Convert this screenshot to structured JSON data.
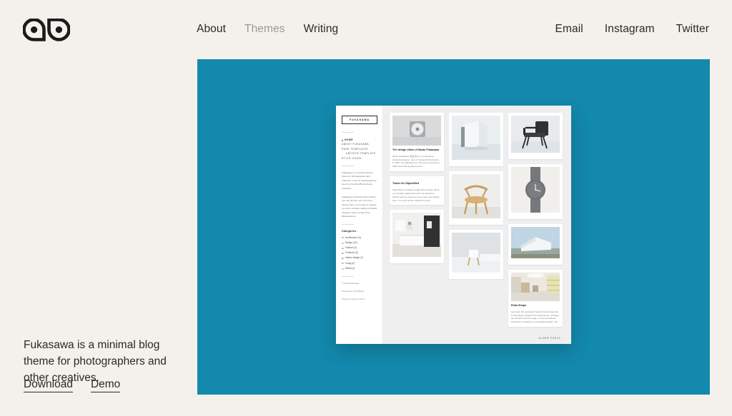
{
  "site": {
    "logo_alt": "fukasawa-double-a-logo",
    "background_color": "#f4f1ec",
    "accent_color": "#1389ad",
    "text_color": "#2b2926"
  },
  "nav_main": [
    {
      "label": "About",
      "state": "default"
    },
    {
      "label": "Themes",
      "state": "muted"
    },
    {
      "label": "Writing",
      "state": "default"
    }
  ],
  "nav_right": [
    {
      "label": "Email"
    },
    {
      "label": "Instagram"
    },
    {
      "label": "Twitter"
    }
  ],
  "hero": {
    "lede": "Fukasawa is a minimal blog theme for photographers and other creatives.",
    "actions": [
      {
        "label": "Download"
      },
      {
        "label": "Demo"
      }
    ]
  },
  "preview": {
    "brand": "FUKASAWA",
    "menu": [
      {
        "label": "Home",
        "current": true,
        "sub": false
      },
      {
        "label": "About Fukasawa",
        "current": false,
        "sub": false
      },
      {
        "label": "Page Templates",
        "current": false,
        "sub": false
      },
      {
        "label": "Archive Template",
        "current": false,
        "sub": true
      },
      {
        "label": "Style Guide",
        "current": false,
        "sub": false
      }
    ],
    "intro_1": "Fukasawa is a minimal masonry theme for photographers and collectors. It can be downloaded for free from the WordPress theme repository.",
    "intro_2": "Fukasawa is built by Anders Norén. You can find the rest of my free themes here. If you want to support my work, consider making a PayPal donation. Demo content from Minimalissimo.",
    "categories_heading": "Categories",
    "categories": [
      {
        "label": "Architecture",
        "count": "3"
      },
      {
        "label": "Design",
        "count": "13"
      },
      {
        "label": "Fashion",
        "count": "2"
      },
      {
        "label": "Furniture",
        "count": "3"
      },
      {
        "label": "Interior design",
        "count": "7"
      },
      {
        "label": "Living",
        "count": "2"
      },
      {
        "label": "Media",
        "count": "1"
      }
    ],
    "footer_1": "© 2015 Fukasawa.",
    "footer_2": "Powered by WordPress.",
    "footer_3": "Theme by Anders Norén.",
    "posts": [
      {
        "title": "The design ethos of Naoto Fukasawa",
        "excerpt": "Naoto Fukasawa (深澤 直人) is a Japanese industrial designer, born in Yamanashi Prefecture in 1956. He graduated from Tama Art University in 1980. After having acted as the...",
        "image": "muji-cd-player"
      },
      {
        "title": "Trailer for Objectified",
        "excerpt": "Objectified is a feature length documentary about our complex relationship with manufactured objects and, by extension, the people who design them. It's a look at the creativity at work...",
        "image": "white-interior-kitchen"
      },
      {
        "title": "Etnia Shops",
        "excerpt": "Last year, the successful Spanish studio Lavernia & Cienfuegos designed the Etnia Shops, including the furniture and the image, for the brand Etnia Cosmetics, resulting in a remarkable project. The...",
        "image": "etnia-shop-interior"
      }
    ],
    "images": [
      {
        "name": "abstract-white-sculpture"
      },
      {
        "name": "black-lounge-chair"
      },
      {
        "name": "wooden-round-chair"
      },
      {
        "name": "grey-minimal-watch"
      },
      {
        "name": "white-modern-building"
      },
      {
        "name": "white-chair-in-empty-room"
      }
    ],
    "older_posts_label": "OLDER POSTS →"
  }
}
